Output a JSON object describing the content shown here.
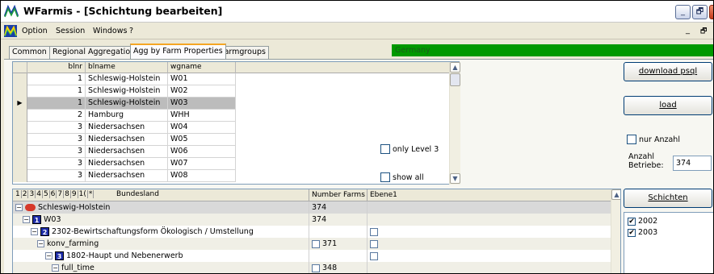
{
  "window": {
    "title": "WFarmis - [Schichtung bearbeiten]",
    "minimize_glyph": "_",
    "restore_glyph": "🗗",
    "close_glyph": "✕"
  },
  "menu": {
    "items": [
      "Option",
      "Session",
      "Windows",
      "?"
    ],
    "mdi_min_glyph": "_",
    "mdi_restore_glyph": "🗗"
  },
  "tabs": [
    {
      "label": "Common"
    },
    {
      "label": "Regional Aggregation"
    },
    {
      "label": "Agg by Farm Properties",
      "active": true
    },
    {
      "label": "Farmgroups"
    }
  ],
  "status_strip": {
    "text": "Germany",
    "color": "#009900"
  },
  "grid": {
    "columns": [
      "blnr",
      "blname",
      "wgname"
    ],
    "selected_marker": "▶",
    "rows": [
      {
        "blnr": "1",
        "blname": "Schleswig-Holstein",
        "wgname": "W01"
      },
      {
        "blnr": "1",
        "blname": "Schleswig-Holstein",
        "wgname": "W02"
      },
      {
        "blnr": "1",
        "blname": "Schleswig-Holstein",
        "wgname": "W03",
        "selected": true
      },
      {
        "blnr": "2",
        "blname": "Hamburg",
        "wgname": "WHH"
      },
      {
        "blnr": "3",
        "blname": "Niedersachsen",
        "wgname": "W04"
      },
      {
        "blnr": "3",
        "blname": "Niedersachsen",
        "wgname": "W05"
      },
      {
        "blnr": "3",
        "blname": "Niedersachsen",
        "wgname": "W06"
      },
      {
        "blnr": "3",
        "blname": "Niedersachsen",
        "wgname": "W07"
      },
      {
        "blnr": "3",
        "blname": "Niedersachsen",
        "wgname": "W08"
      }
    ],
    "scroll_up_glyph": "▲",
    "scroll_down_glyph": "▼"
  },
  "options": {
    "only_level3": {
      "label": "only Level 3",
      "checked": false
    },
    "show_all": {
      "label": "show all",
      "checked": false
    }
  },
  "right_panel": {
    "download_label": "download psql",
    "load_label": "load",
    "nur_anzahl": {
      "label": "nur Anzahl",
      "checked": false
    },
    "anzahl_label": "Anzahl Betriebe:",
    "anzahl_value": "374",
    "schichten_label": "Schichten",
    "years": [
      {
        "label": "2002",
        "checked": true
      },
      {
        "label": "2003",
        "checked": true
      }
    ],
    "check_glyph": "✔"
  },
  "tree": {
    "level_headers": [
      "1",
      "2",
      "3",
      "4",
      "5",
      "6",
      "7",
      "8",
      "9",
      "1(",
      "*"
    ],
    "col_bundesland": "Bundesland",
    "col_number_farms": "Number Farms",
    "col_ebene1": "Ebene1",
    "toggle_glyph": "−",
    "rows": [
      {
        "label": "Schleswig-Holstein",
        "level_badge": "",
        "number": "374",
        "has_num_check": false,
        "has_ebene_check": false
      },
      {
        "label": "W03",
        "level_badge": "1",
        "number": "374",
        "has_num_check": false,
        "has_ebene_check": false
      },
      {
        "label": "2302-Bewirtschaftungsform Ökologisch / Umstellung",
        "level_badge": "2",
        "number": "",
        "has_num_check": false,
        "has_ebene_check": true
      },
      {
        "label": "konv_farming",
        "level_badge": "",
        "number": "371",
        "has_num_check": true,
        "has_ebene_check": true
      },
      {
        "label": "1802-Haupt und Nebenerwerb",
        "level_badge": "3",
        "number": "",
        "has_num_check": false,
        "has_ebene_check": true
      },
      {
        "label": "full_time",
        "level_badge": "",
        "number": "348",
        "has_num_check": true,
        "has_ebene_check": false
      }
    ]
  },
  "colors": {
    "accent_tab": "#f5a623",
    "selection_gray": "#bcbcbc",
    "level_icon_blue": "#1c2ba8",
    "root_icon_red": "#d6382a"
  }
}
